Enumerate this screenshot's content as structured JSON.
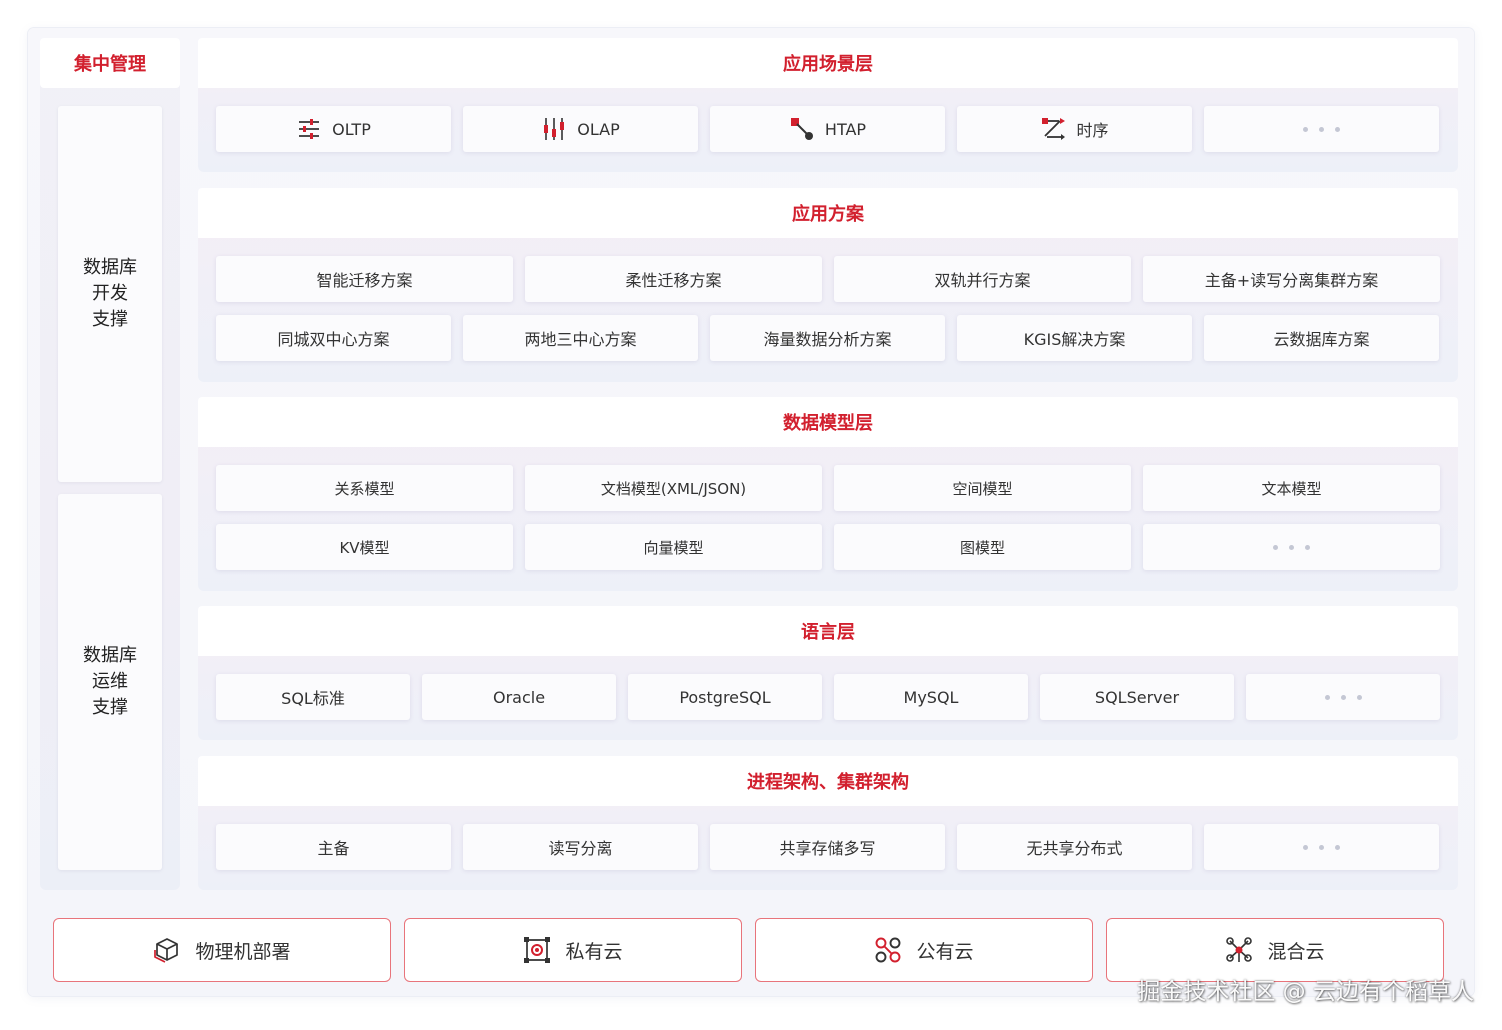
{
  "left_column": {
    "header": "集中管理",
    "dev_support": "数据库\n开发\n支撑",
    "ops_support": "数据库\n运维\n支撑"
  },
  "layers": {
    "scenario": {
      "title": "应用场景层",
      "items": [
        {
          "label": "OLTP",
          "icon": "sliders-icon"
        },
        {
          "label": "OLAP",
          "icon": "candlestick-icon"
        },
        {
          "label": "HTAP",
          "icon": "linked-nodes-icon"
        },
        {
          "label": "时序",
          "icon": "timeline-icon"
        }
      ]
    },
    "solution": {
      "title": "应用方案",
      "row1": [
        "智能迁移方案",
        "柔性迁移方案",
        "双轨并行方案",
        "主备+读写分离集群方案"
      ],
      "row2": [
        "同城双中心方案",
        "两地三中心方案",
        "海量数据分析方案",
        "KGIS解决方案",
        "云数据库方案"
      ]
    },
    "datamodel": {
      "title": "数据模型层",
      "row1": [
        "关系模型",
        "文档模型(XML/JSON)",
        "空间模型",
        "文本模型"
      ],
      "row2": [
        "KV模型",
        "向量模型",
        "图模型"
      ]
    },
    "language": {
      "title": "语言层",
      "items": [
        "SQL标准",
        "Oracle",
        "PostgreSQL",
        "MySQL",
        "SQLServer"
      ]
    },
    "architecture": {
      "title": "进程架构、集群架构",
      "items": [
        "主备",
        "读写分离",
        "共享存储多写",
        "无共享分布式"
      ]
    }
  },
  "deployment": [
    {
      "label": "物理机部署",
      "icon": "cube-icon"
    },
    {
      "label": "私有云",
      "icon": "private-cloud-icon"
    },
    {
      "label": "公有云",
      "icon": "public-cloud-icon"
    },
    {
      "label": "混合云",
      "icon": "hybrid-cloud-icon"
    }
  ],
  "watermark": "掘金技术社区 @ 云边有个稻草人",
  "colors": {
    "accent": "#d2202e",
    "border": "#e8747b",
    "icon_dark": "#333333"
  }
}
